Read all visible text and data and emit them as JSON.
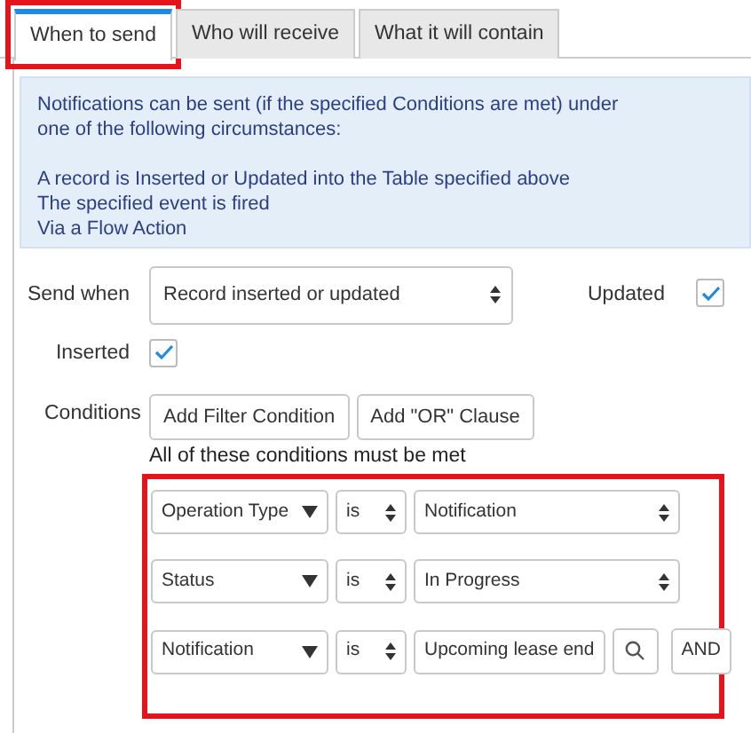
{
  "tabs": [
    {
      "label": "When to send",
      "selected": true,
      "highlighted": true
    },
    {
      "label": "Who will receive",
      "selected": false,
      "highlighted": false
    },
    {
      "label": "What it will contain",
      "selected": false,
      "highlighted": false
    }
  ],
  "info": {
    "paragraphs": [
      [
        "Notifications can be sent (if the specified Conditions are met) under",
        "one of the following circumstances:"
      ],
      [
        "A record is Inserted or Updated into the Table specified above",
        "The specified event is fired",
        "Via a Flow Action"
      ]
    ]
  },
  "send_when": {
    "label": "Send when",
    "value": "Record inserted or updated"
  },
  "updated": {
    "label": "Updated",
    "checked": true
  },
  "inserted": {
    "label": "Inserted",
    "checked": true
  },
  "conditions": {
    "label": "Conditions",
    "buttons": [
      "Add Filter Condition",
      "Add \"OR\" Clause"
    ],
    "caption": "All of these conditions must be met",
    "highlighted": true,
    "rows": [
      {
        "kind": "choice",
        "field": "Operation Type",
        "operator": "is",
        "value": "Notification"
      },
      {
        "kind": "choice",
        "field": "Status",
        "operator": "is",
        "value": "In Progress"
      },
      {
        "kind": "reference",
        "field": "Notification",
        "operator": "is",
        "value": "Upcoming lease end",
        "action": "AND"
      }
    ]
  }
}
